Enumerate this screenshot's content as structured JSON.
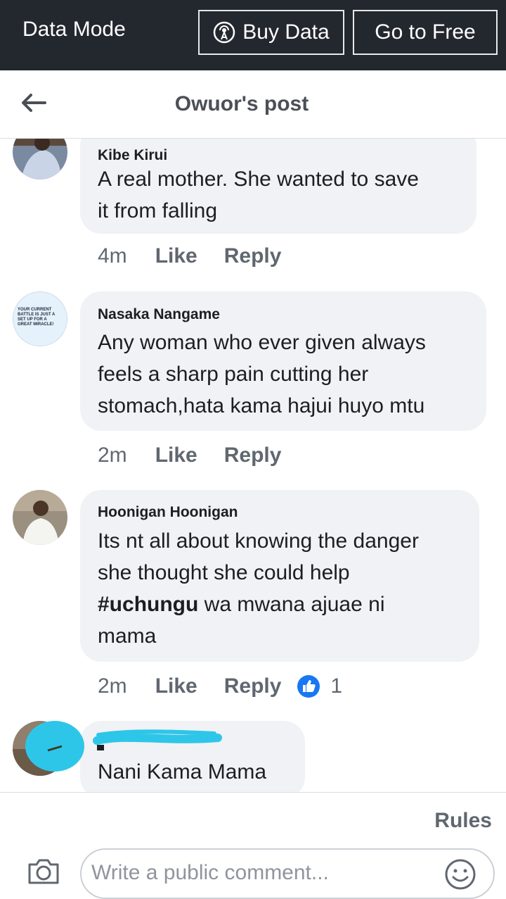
{
  "databar": {
    "mode_label": "Data Mode",
    "buy_label": "Buy Data",
    "free_label": "Go to Free"
  },
  "header": {
    "title": "Owuor's post"
  },
  "comments": [
    {
      "name": "Kibe Kirui",
      "text": "A real mother. She wanted to save\nit from falling",
      "time": "4m",
      "like": "Like",
      "reply": "Reply"
    },
    {
      "name": "Nasaka Nangame",
      "avatar_text": "YOUR CURRENT BATTLE IS JUST A SET UP FOR A GREAT MIRACLE!",
      "text": "Any woman who ever given always\nfeels a sharp pain cutting her\nstomach,hata kama hajui huyo mtu",
      "time": "2m",
      "like": "Like",
      "reply": "Reply"
    },
    {
      "name": "Hoonigan Hoonigan",
      "text_before": "Its nt all about knowing the danger\nshe thought she could help\n",
      "hashtag": "#uchungu",
      "text_after": " wa mwana ajuae ni\nmama",
      "time": "2m",
      "like": "Like",
      "reply": "Reply",
      "reaction_count": "1"
    },
    {
      "text": "Nani Kama Mama"
    }
  ],
  "footer": {
    "rules_label": "Rules",
    "compose_placeholder": "Write a public comment..."
  },
  "colors": {
    "topbar": "#23272e",
    "bubble": "#f0f2f5",
    "meta": "#606770",
    "like_blue": "#1877f2",
    "redaction": "#2ec6e8"
  }
}
